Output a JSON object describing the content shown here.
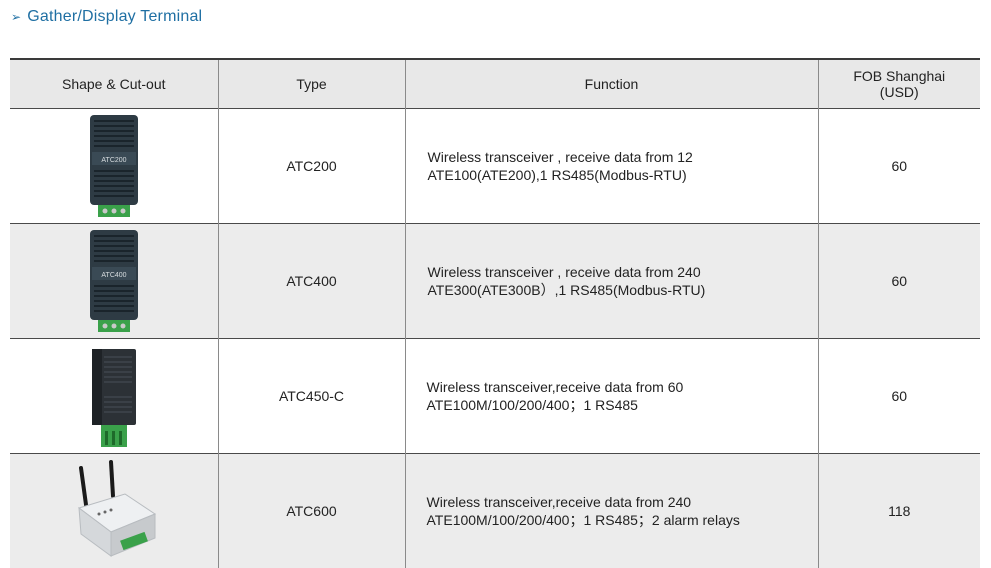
{
  "section": {
    "arrow": "➢",
    "title": "Gather/Display Terminal"
  },
  "table": {
    "headers": {
      "shape": "Shape & Cut-out",
      "type": "Type",
      "function": "Function",
      "fob_line1": "FOB Shanghai",
      "fob_line2": "(USD)"
    },
    "rows": [
      {
        "device_label": "ATC200",
        "type": "ATC200",
        "function_line1": "Wireless transceiver , receive data from 12",
        "function_line2": "ATE100(ATE200),1 RS485(Modbus-RTU)",
        "price": "60"
      },
      {
        "device_label": "ATC400",
        "type": "ATC400",
        "function_line1": "Wireless transceiver , receive data from 240",
        "function_line2": "ATE300(ATE300B）,1 RS485(Modbus-RTU)",
        "price": "60"
      },
      {
        "type": "ATC450-C",
        "function_line1": "Wireless transceiver,receive data from 60",
        "function_line2": "ATE100M/100/200/400；1 RS485",
        "price": "60"
      },
      {
        "type": "ATC600",
        "function_line1": "Wireless transceiver,receive data from 240",
        "function_line2": "ATE100M/100/200/400；1 RS485；2 alarm relays",
        "price": "118"
      }
    ]
  }
}
